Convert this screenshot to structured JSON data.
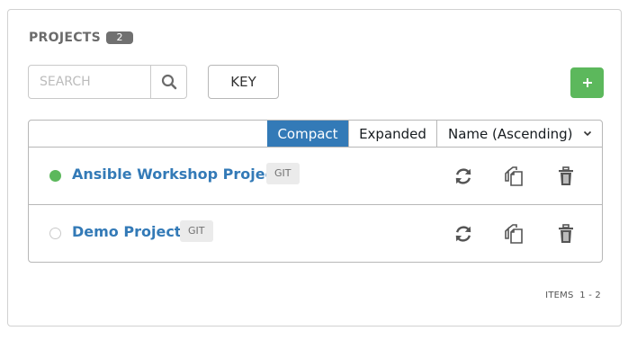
{
  "panel": {
    "title": "PROJECTS",
    "count": "2"
  },
  "search": {
    "placeholder": "SEARCH",
    "value": "",
    "icon": "search-icon"
  },
  "toolbar": {
    "key_label": "KEY",
    "add_icon": "plus-icon",
    "add_color": "#5cb85c"
  },
  "view": {
    "compact_label": "Compact",
    "expanded_label": "Expanded",
    "active": "Compact",
    "active_color": "#337ab7"
  },
  "sort": {
    "selected": "Name (Ascending)"
  },
  "projects": [
    {
      "name": "Ansible Workshop Project",
      "scm_type": "GIT",
      "status": "successful",
      "status_color": "#5cb85c"
    },
    {
      "name": "Demo Project",
      "scm_type": "GIT",
      "status": "never updated",
      "status_color": "#c9c9c9"
    }
  ],
  "row_actions": {
    "icons": [
      "sync-icon",
      "copy-icon",
      "trash-icon"
    ]
  },
  "footer": {
    "items_label": "ITEMS",
    "range": "1 - 2"
  }
}
